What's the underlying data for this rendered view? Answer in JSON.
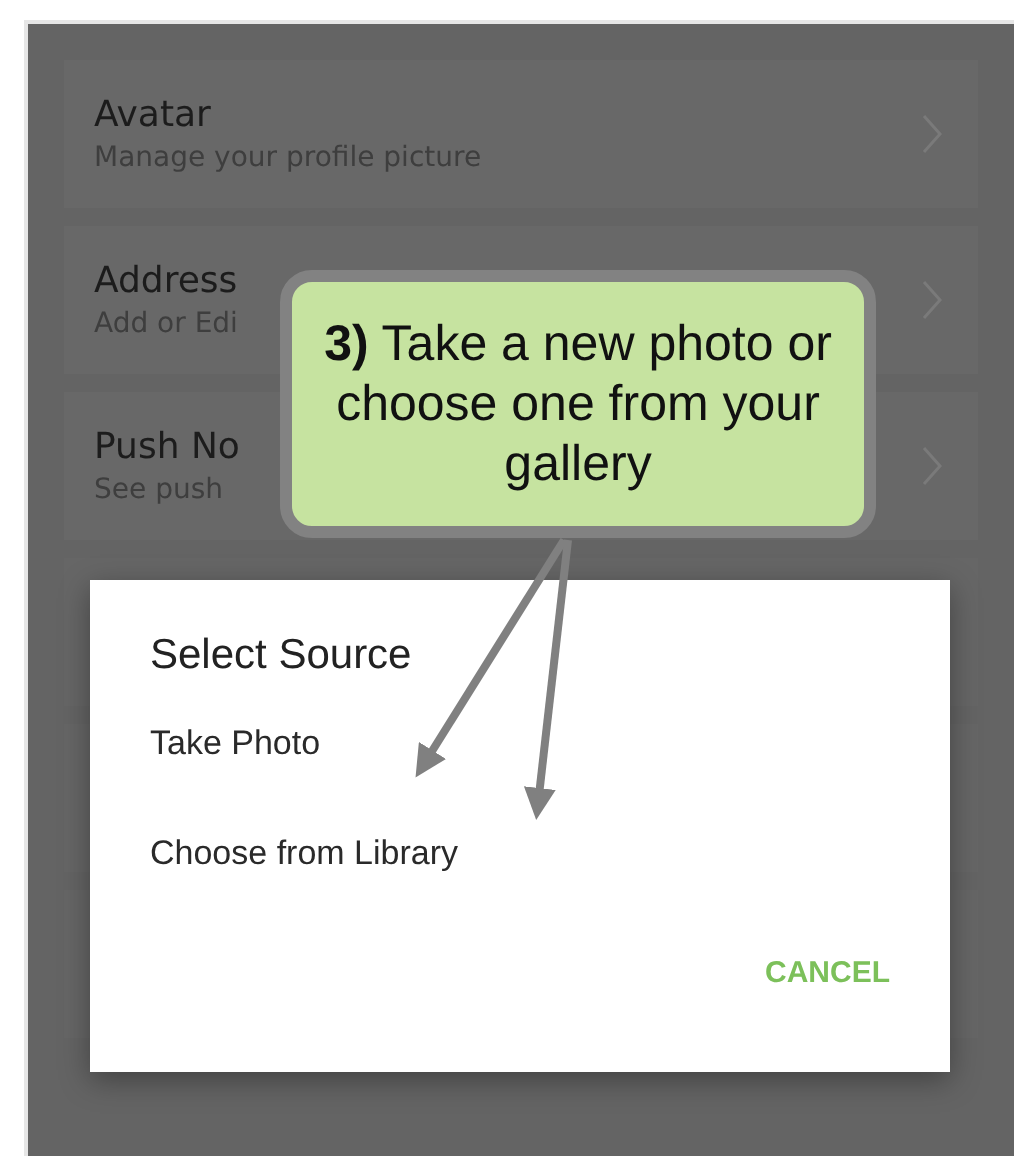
{
  "settings": [
    {
      "title": "Avatar",
      "subtitle": "Manage your profile picture"
    },
    {
      "title": "Address",
      "subtitle": "Add or Edi"
    },
    {
      "title": "Push No",
      "subtitle": "See push"
    }
  ],
  "dialog": {
    "title": "Select Source",
    "options": [
      "Take Photo",
      "Choose from Library"
    ],
    "buttons": [
      "CANCEL"
    ]
  },
  "callout": {
    "text": "**3)** Take a new photo or choose one from your gallery"
  }
}
